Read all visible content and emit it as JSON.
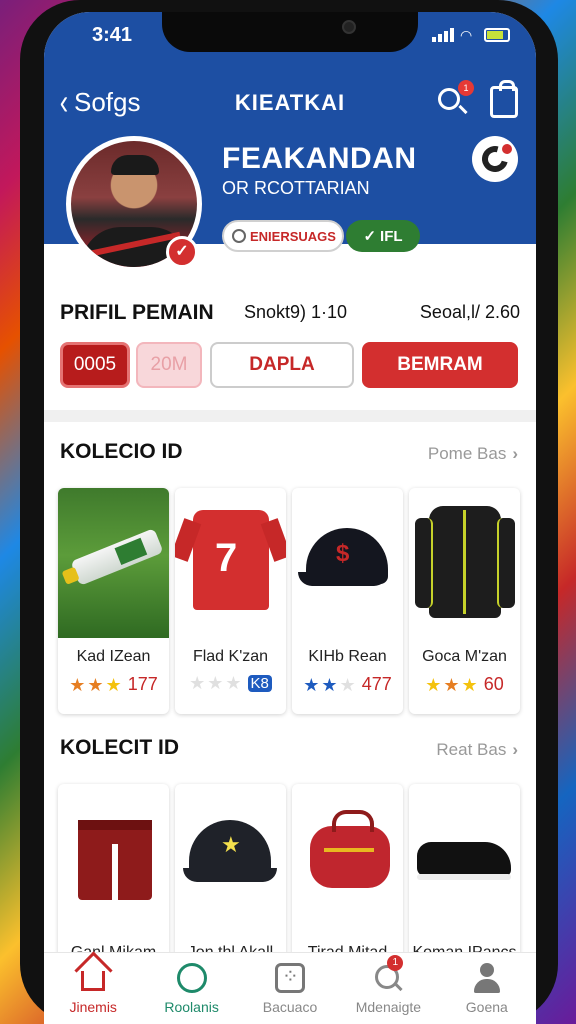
{
  "status": {
    "time": "3:41"
  },
  "nav": {
    "back_label": "Sofgs",
    "title": "KIEATKAI",
    "search_badge": "1"
  },
  "player": {
    "name": "FEAKANDAN",
    "subtitle": "OR RCOTTARIAN",
    "search_pill": "ENIERSUAGS",
    "status_pill": "IFL"
  },
  "profile": {
    "title": "PRIFIL PEMAIN",
    "stat_left": "Snokt9) 1·10",
    "stat_right": "Seoal,l/ 2.60",
    "buttons": [
      "0005",
      "20M",
      "DAPLA",
      "BEMRAM"
    ]
  },
  "section1": {
    "title": "KOLECIO ID",
    "link": "Pome Bas",
    "items": [
      {
        "name": "Kad IZean",
        "rating": "177",
        "stars": [
          "or",
          "or",
          "yl"
        ]
      },
      {
        "name": "Flad K'zan",
        "rating": "K8",
        "stars": [
          "gr",
          "gr",
          "gr"
        ]
      },
      {
        "name": "KIHb Rean",
        "rating": "477",
        "stars": [
          "bl",
          "bl",
          "gr"
        ]
      },
      {
        "name": "Goca M'zan",
        "rating": "60",
        "stars": [
          "yl",
          "or",
          "yl"
        ]
      }
    ]
  },
  "section2": {
    "title": "KOLECIT ID",
    "link": "Reat Bas",
    "items": [
      {
        "name": "Ganl Mikam"
      },
      {
        "name": "Jon thl Akall"
      },
      {
        "name": "Tirad Mitad"
      },
      {
        "name": "Koman IPancs"
      }
    ]
  },
  "tabs": [
    {
      "label": "Jinemis",
      "icon": "home-icon"
    },
    {
      "label": "Roolanis",
      "icon": "refresh-icon"
    },
    {
      "label": "Bacuaco",
      "icon": "grid-icon"
    },
    {
      "label": "Mdenaigte",
      "icon": "search-icon",
      "badge": "1"
    },
    {
      "label": "Goena",
      "icon": "user-icon"
    }
  ],
  "colors": {
    "brand_blue": "#1d4fa3",
    "accent_red": "#d32f2f",
    "green": "#2e7d32"
  }
}
